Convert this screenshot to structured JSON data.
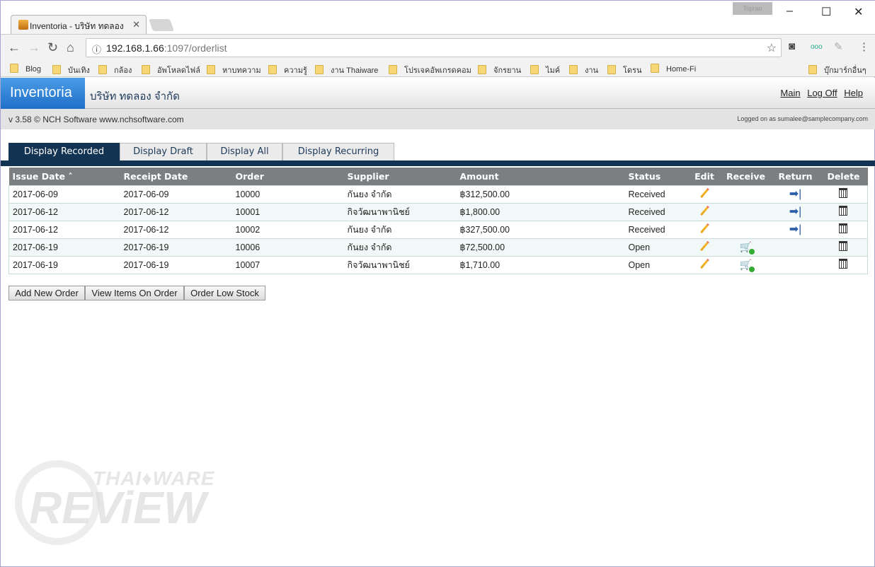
{
  "browser": {
    "tab_title": "Inventoria - บริษัท ทดลอง",
    "url_host": "192.168.1.66",
    "url_path": ":1097/orderlist",
    "user_badge": "Tsprao",
    "bookmarks": [
      "Blog",
      "บันเทิง",
      "กล้อง",
      "อัพโหลดไฟล์",
      "หาบทความ",
      "ความรู้",
      "งาน Thaiware",
      "โปรเจคอัพเกรดคอม",
      "จักรยาน",
      "ไมค์",
      "งาน",
      "โดรน",
      "Home-Fi"
    ],
    "other_bookmarks": "บุ๊กมาร์กอื่นๆ"
  },
  "app": {
    "logo": "Inventoria",
    "company": "บริษัท ทดลอง จำกัด",
    "links": [
      "Main",
      "Log Off",
      "Help"
    ],
    "version": "v 3.58 © NCH Software ",
    "website": "www.nchsoftware.com",
    "logged_on": "Logged on as sumalee@samplecompany.com"
  },
  "tabs": [
    "Display Recorded",
    "Display Draft",
    "Display All",
    "Display Recurring"
  ],
  "active_tab": "Display Recorded",
  "table": {
    "headers": [
      "Issue Date ˄",
      "Receipt Date",
      "Order",
      "Supplier",
      "Amount",
      "Status",
      "Edit",
      "Receive",
      "Return",
      "Delete"
    ],
    "rows": [
      {
        "issue": "2017-06-09",
        "receipt": "2017-06-09",
        "order": "10000",
        "supplier": "กันยง จำกัด",
        "amount": "฿312,500.00",
        "status": "Received",
        "receive": false,
        "return": true
      },
      {
        "issue": "2017-06-12",
        "receipt": "2017-06-12",
        "order": "10001",
        "supplier": "กิจวัฒนาพานิชย์",
        "amount": "฿1,800.00",
        "status": "Received",
        "receive": false,
        "return": true
      },
      {
        "issue": "2017-06-12",
        "receipt": "2017-06-12",
        "order": "10002",
        "supplier": "กันยง จำกัด",
        "amount": "฿327,500.00",
        "status": "Received",
        "receive": false,
        "return": true
      },
      {
        "issue": "2017-06-19",
        "receipt": "2017-06-19",
        "order": "10006",
        "supplier": "กันยง จำกัด",
        "amount": "฿72,500.00",
        "status": "Open",
        "receive": true,
        "return": false
      },
      {
        "issue": "2017-06-19",
        "receipt": "2017-06-19",
        "order": "10007",
        "supplier": "กิจวัฒนาพานิชย์",
        "amount": "฿1,710.00",
        "status": "Open",
        "receive": true,
        "return": false
      }
    ]
  },
  "buttons": [
    "Add New Order",
    "View Items On Order",
    "Order Low Stock"
  ],
  "watermark": {
    "top": "THAIWARE",
    "bottom": "REVIEW"
  },
  "colors": {
    "accent": "#133352",
    "logo": "#2f80d8",
    "header": "#7b7f82"
  }
}
